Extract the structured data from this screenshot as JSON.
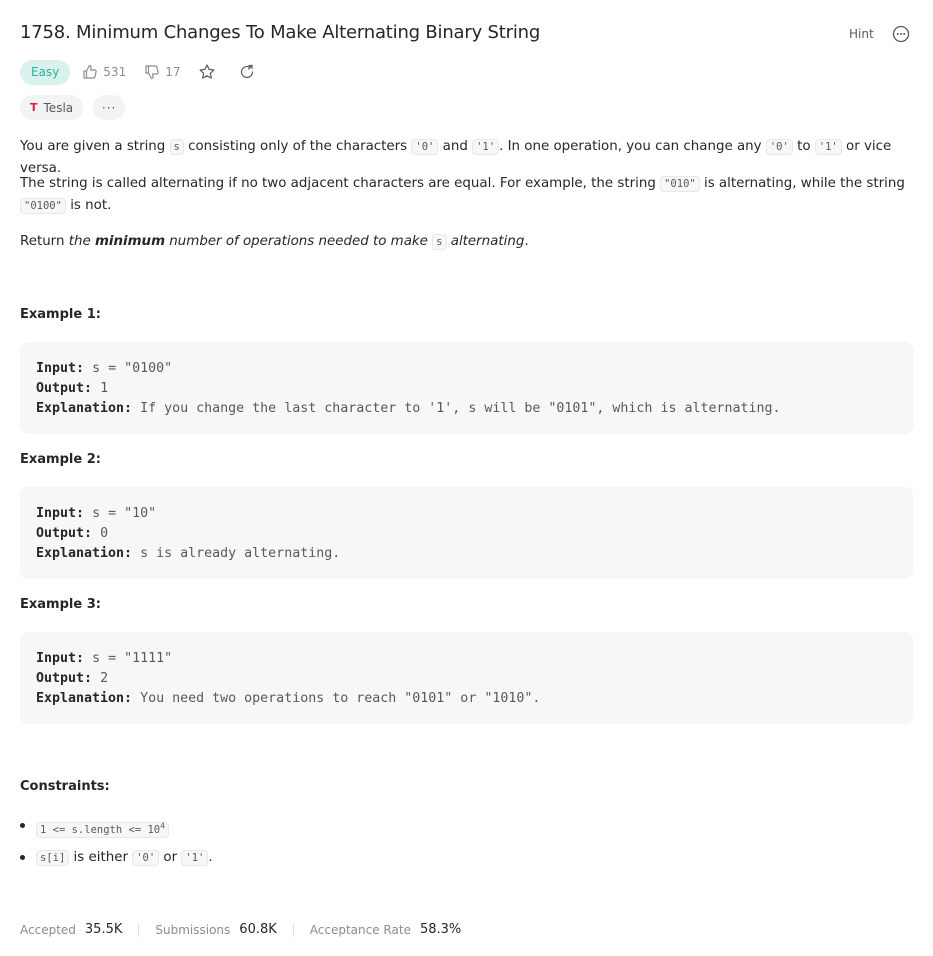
{
  "problem": {
    "title": "1758. Minimum Changes To Make Alternating Binary String",
    "hint_label": "Hint",
    "difficulty": "Easy",
    "likes": "531",
    "dislikes": "17",
    "company": "Tesla",
    "more_tags": "···"
  },
  "description": {
    "p1": [
      "You are given a string ",
      "s",
      " consisting only of the characters ",
      "'0'",
      " and ",
      "'1'",
      ". In one operation, you can change any ",
      "'0'",
      " to ",
      "'1'",
      " or vice versa."
    ],
    "p2a": [
      "The string is called alternating if no two adjacent characters are equal. For example, the string ",
      "\"010\"",
      " is alternating, while the string"
    ],
    "p2b": [
      "\"0100\"",
      " is not."
    ],
    "p3": [
      "Return ",
      "the ",
      "minimum",
      " number of operations needed to make ",
      "s",
      " alternating",
      "."
    ]
  },
  "examples": [
    {
      "heading": "Example 1:",
      "input_label": "Input:",
      "input": "s = \"0100\"",
      "output_label": "Output:",
      "output": "1",
      "explanation_label": "Explanation:",
      "explanation": "If you change the last character to '1', s will be \"0101\", which is alternating."
    },
    {
      "heading": "Example 2:",
      "input_label": "Input:",
      "input": "s = \"10\"",
      "output_label": "Output:",
      "output": "0",
      "explanation_label": "Explanation:",
      "explanation": "s is already alternating."
    },
    {
      "heading": "Example 3:",
      "input_label": "Input:",
      "input": "s = \"1111\"",
      "output_label": "Output:",
      "output": "2",
      "explanation_label": "Explanation:",
      "explanation": "You need two operations to reach \"0101\" or \"1010\"."
    }
  ],
  "constraints": {
    "heading": "Constraints:",
    "c1_code": "1 <= s.length <= 10",
    "c1_sup": "4",
    "c2": [
      "s[i]",
      " is either ",
      "'0'",
      " or ",
      "'1'",
      "."
    ]
  },
  "stats": {
    "accepted_label": "Accepted",
    "accepted": "35.5K",
    "submissions_label": "Submissions",
    "submissions": "60.8K",
    "rate_label": "Acceptance Rate",
    "rate": "58.3%"
  }
}
